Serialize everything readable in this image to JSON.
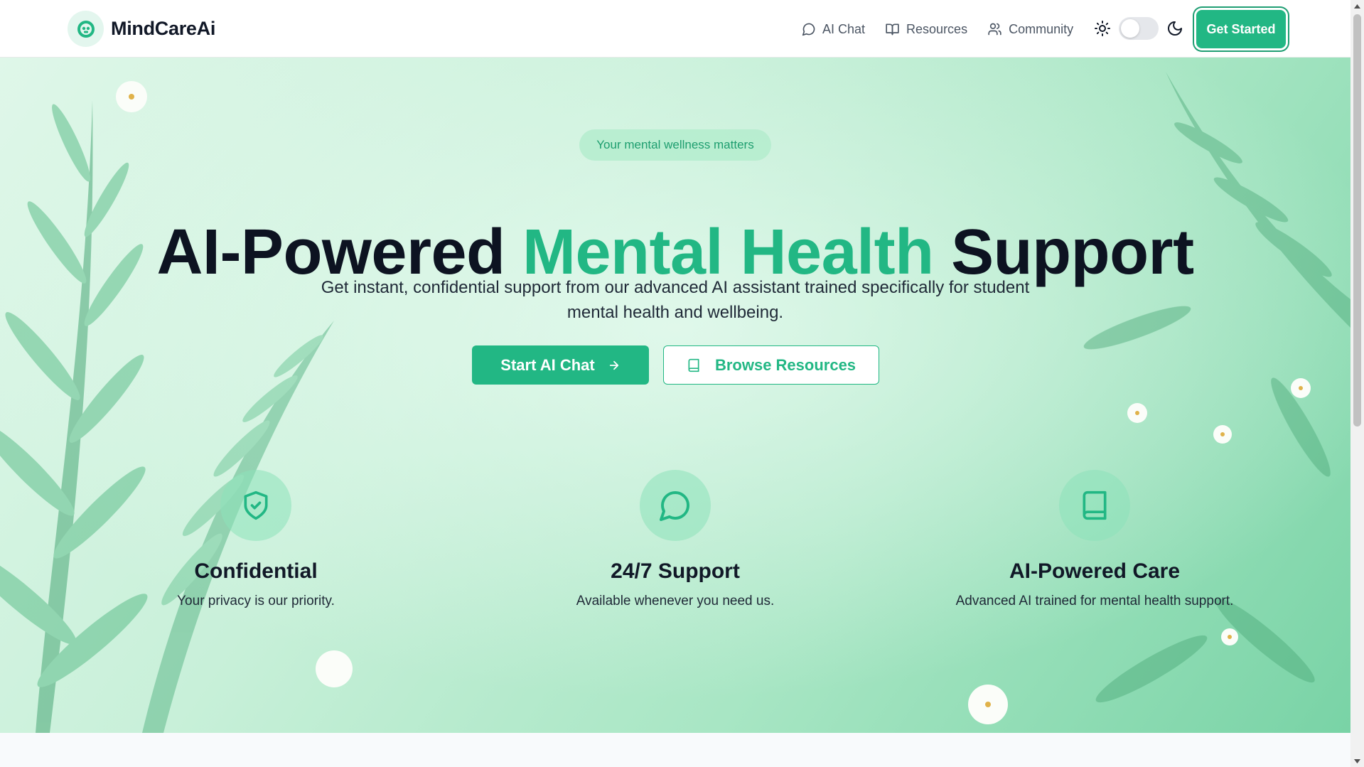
{
  "brand": {
    "name": "MindCareAi",
    "logo_icon": "brain-face-icon"
  },
  "nav": {
    "items": [
      {
        "label": "AI Chat",
        "icon": "message-circle-icon"
      },
      {
        "label": "Resources",
        "icon": "book-open-icon"
      },
      {
        "label": "Community",
        "icon": "users-icon"
      }
    ],
    "theme": {
      "light_icon": "sun-icon",
      "dark_icon": "moon-icon",
      "dark_mode": false
    },
    "cta_label": "Get Started"
  },
  "hero": {
    "badge": "Your mental wellness matters",
    "title_prefix": "AI-Powered ",
    "title_accent": "Mental Health",
    "title_suffix": " Support",
    "subtitle": "Get instant, confidential support from our advanced AI assistant trained specifically for student mental health and wellbeing.",
    "primary_button": "Start AI Chat",
    "secondary_button": "Browse Resources"
  },
  "features": [
    {
      "title": "Confidential",
      "description": "Your privacy is our priority.",
      "icon": "shield-check-icon"
    },
    {
      "title": "24/7 Support",
      "description": "Available whenever you need us.",
      "icon": "message-circle-icon"
    },
    {
      "title": "AI-Powered Care",
      "description": "Advanced AI trained for mental health support.",
      "icon": "book-icon"
    }
  ],
  "colors": {
    "accent": "#22b784",
    "heading": "#0d1321",
    "badge_text": "#1e9e6f"
  }
}
